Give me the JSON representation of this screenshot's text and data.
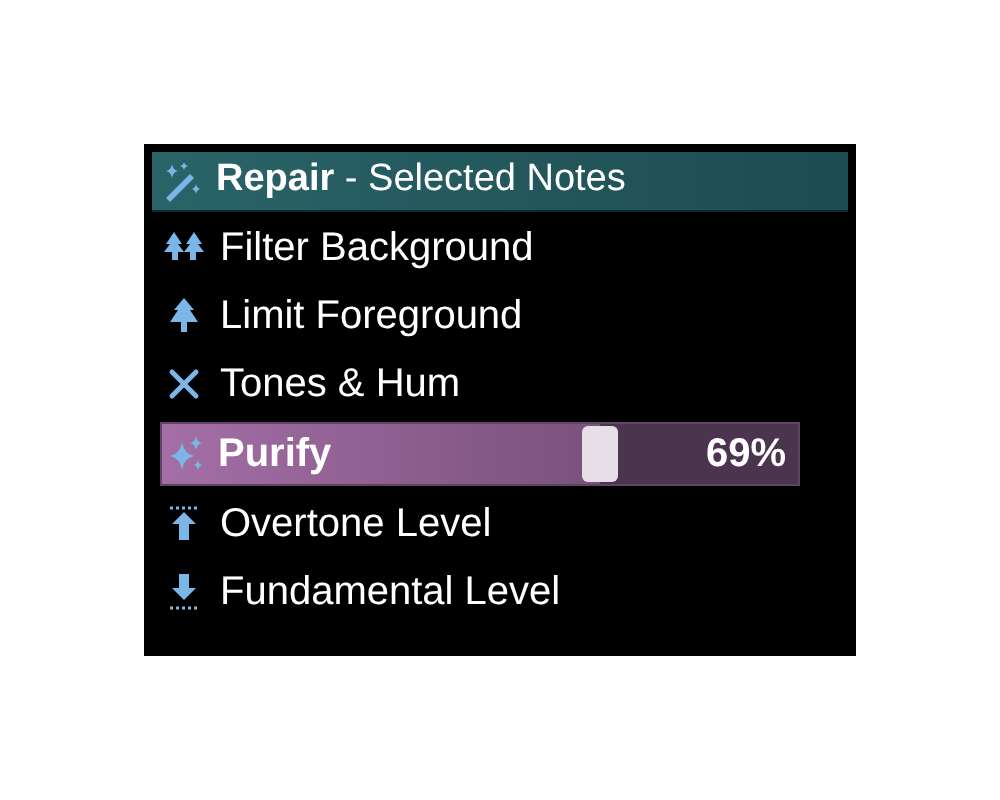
{
  "header": {
    "title": "**Repair** - Selected Notes"
  },
  "items": [
    {
      "kind": "action",
      "label": "Filter Background"
    },
    {
      "kind": "action",
      "label": "Limit Foreground"
    },
    {
      "kind": "action",
      "label": "Tones & Hum"
    },
    {
      "kind": "slider",
      "label": "Purify",
      "level": 0.69,
      "reading": "69%"
    },
    {
      "kind": "action",
      "label": "Overtone Level"
    },
    {
      "kind": "action",
      "label": "Fundamental Level"
    }
  ]
}
